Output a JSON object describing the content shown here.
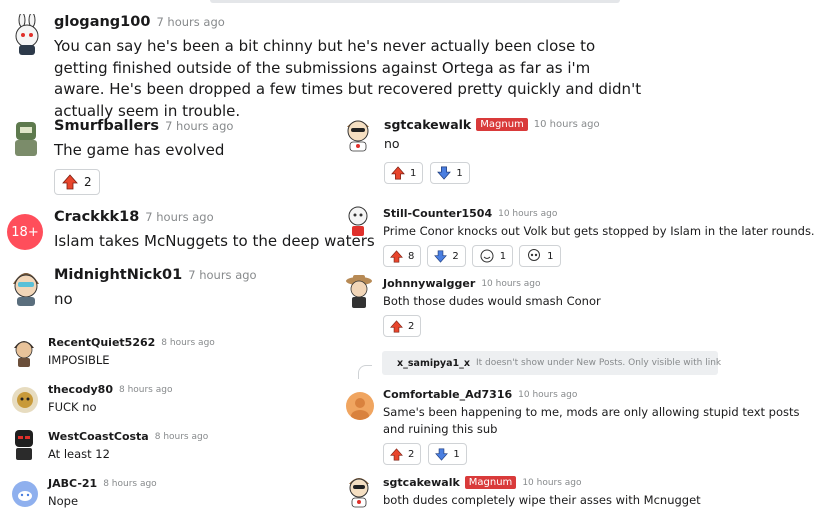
{
  "colors": {
    "upvote": "#e8452c",
    "downvote": "#4a7ee0",
    "flair": "#d93a3a",
    "muted": "#878a8c"
  },
  "comments": {
    "glogang": {
      "user": "glogang100",
      "time": "7 hours ago",
      "body": "You can say he's been a bit chinny but he's never actually been close to getting finished outside of the submissions against Ortega as far as i'm aware. He's been dropped a few times but recovered pretty quickly and didn't actually seem in trouble."
    },
    "smurf": {
      "user": "Smurfballers",
      "time": "7 hours ago",
      "body": "The game has evolved",
      "upvotes": "2"
    },
    "crackk": {
      "user": "Crackkk18",
      "time": "7 hours ago",
      "body": "Islam takes McNuggets to the deep waters",
      "avatar_text": "18+"
    },
    "midnight": {
      "user": "MidnightNick01",
      "time": "7 hours ago",
      "body": "no"
    },
    "recent": {
      "user": "RecentQuiet5262",
      "time": "8 hours ago",
      "body": "IMPOSIBLE"
    },
    "cody": {
      "user": "thecody80",
      "time": "8 hours ago",
      "body": "FUCK no"
    },
    "westcoast": {
      "user": "WestCoastCosta",
      "time": "8 hours ago",
      "body": "At least 12"
    },
    "jabc": {
      "user": "JABC-21",
      "time": "8 hours ago",
      "body": "Nope"
    },
    "sgt1": {
      "user": "sgtcakewalk",
      "flair": "Magnum",
      "time": "10 hours ago",
      "body": "no",
      "upvotes": "1",
      "downvotes": "1"
    },
    "still": {
      "user": "Still-Counter1504",
      "time": "10 hours ago",
      "body": "Prime Conor knocks out Volk but gets stopped by Islam in the later rounds.",
      "upvotes": "8",
      "downvotes": "2",
      "award1": "1",
      "award2": "1"
    },
    "johnny": {
      "user": "Johnnywalgger",
      "time": "10 hours ago",
      "body": "Both those dudes would smash Conor",
      "upvotes": "2"
    },
    "notice": {
      "user": "x_samipya1_x",
      "text": "It doesn't show under New Posts. Only visible with link"
    },
    "comfortable": {
      "user": "Comfortable_Ad7316",
      "time": "10 hours ago",
      "body": "Same's been happening to me, mods are only allowing stupid text posts and ruining this sub",
      "upvotes": "2",
      "downvotes": "1"
    },
    "sgt2": {
      "user": "sgtcakewalk",
      "flair": "Magnum",
      "time": "10 hours ago",
      "body": "both dudes completely wipe their asses with Mcnugget"
    }
  }
}
